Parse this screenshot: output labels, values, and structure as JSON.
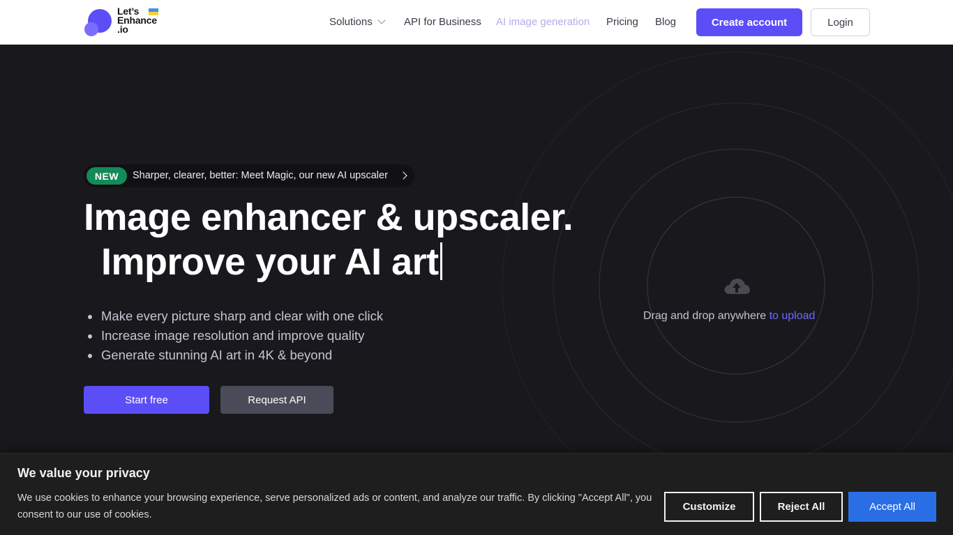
{
  "nav": {
    "logo_text": "Let’s\nEnhance\n.io",
    "links": {
      "solutions": "Solutions",
      "api_business": "API for Business",
      "ai_generation": "AI image generation",
      "pricing": "Pricing",
      "blog": "Blog"
    },
    "create_account": "Create account",
    "login": "Login"
  },
  "hero": {
    "badge_new": "NEW",
    "badge_text": "Sharper, clearer, better: Meet Magic, our new AI upscaler",
    "title_line1": "Image enhancer & upscaler.",
    "title_line2": "Improve your AI art",
    "bullets": [
      "Make every picture sharp and clear with one click",
      "Increase image resolution and improve quality",
      "Generate stunning AI art in 4K & beyond"
    ],
    "start_free": "Start free",
    "request_api": "Request API",
    "upload_text": "Drag and drop anywhere",
    "upload_link": "to upload"
  },
  "cookie": {
    "title": "We value your privacy",
    "body": "We use cookies to enhance your browsing experience, serve personalized ads or content, and analyze our traffic. By clicking \"Accept All\", you consent to our use of cookies.",
    "customize": "Customize",
    "reject_all": "Reject All",
    "accept_all": "Accept All"
  },
  "colors": {
    "accent": "#5b4ef7",
    "background": "#19191d",
    "badge_green": "#148a5a",
    "accept_blue": "#2a6ee6"
  },
  "icons": {
    "logo": "letsenhance-logo-icon",
    "flag": "ukraine-flag-icon",
    "chevron": "chevron-down-icon",
    "badge_arrow": "chevron-right-icon",
    "upload": "cloud-upload-icon"
  }
}
